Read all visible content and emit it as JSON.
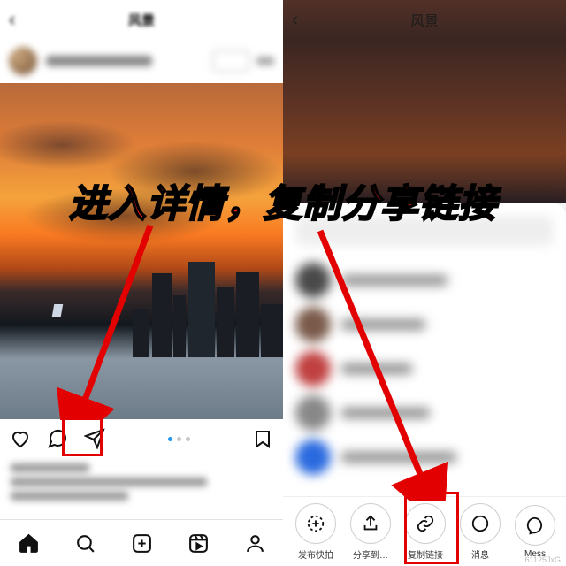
{
  "annotation": {
    "headline": "进入详情，复制分享链接"
  },
  "left": {
    "header_title": "风景",
    "username_blur": "username",
    "actions": {
      "like": "like",
      "comment": "comment",
      "share": "share",
      "bookmark": "bookmark"
    },
    "nav": {
      "home": "home",
      "search": "search",
      "create": "create",
      "reels": "reels",
      "profile": "profile"
    }
  },
  "right": {
    "header_title": "风景",
    "share_actions": [
      {
        "key": "quickshot",
        "label": "发布快拍"
      },
      {
        "key": "shareto",
        "label": "分享到…"
      },
      {
        "key": "copylink",
        "label": "复制链接"
      },
      {
        "key": "messages",
        "label": "消息"
      },
      {
        "key": "messenger",
        "label": "Mess"
      }
    ]
  },
  "watermark": "61125JxG"
}
